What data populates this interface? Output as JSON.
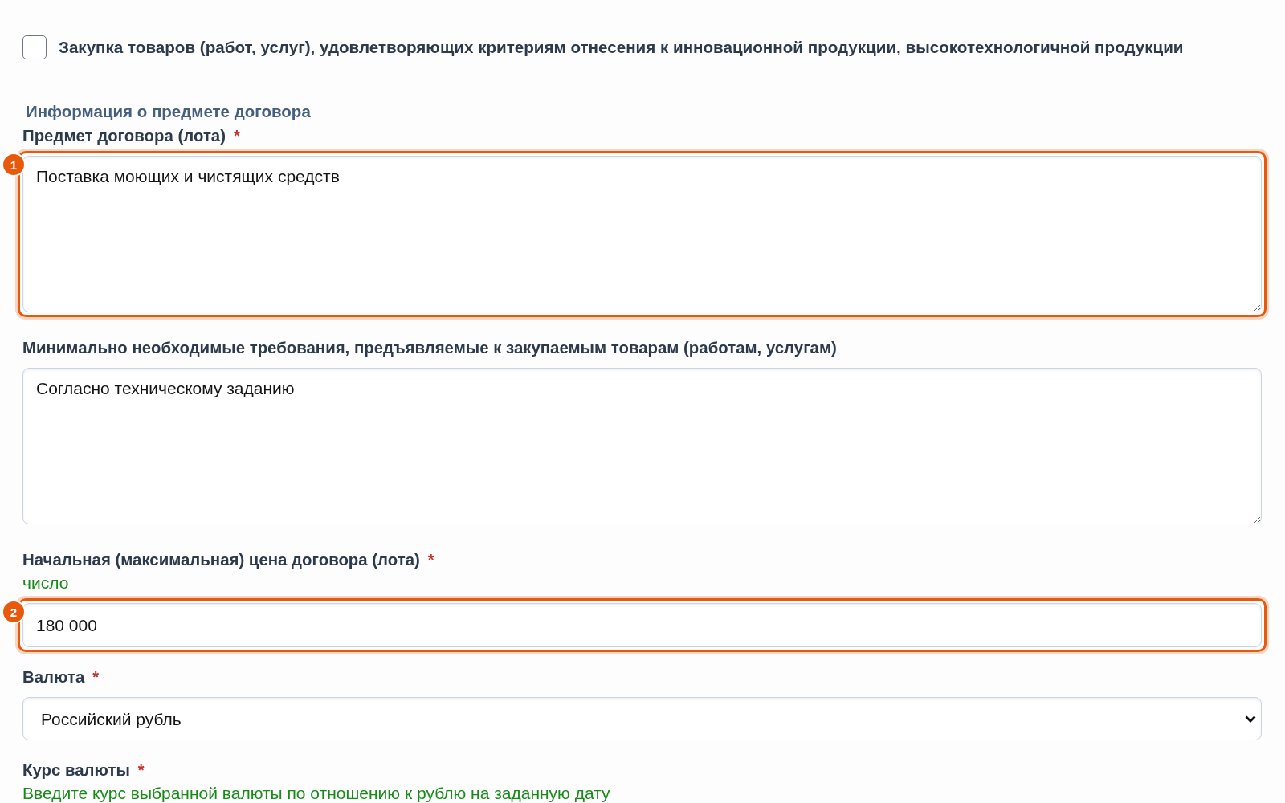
{
  "checkbox": {
    "label": "Закупка товаров (работ, услуг), удовлетворяющих критериям отнесения к инновационной продукции, высокотехнологичной продукции",
    "checked": false
  },
  "section_title": "Информация о предмете договора",
  "fields": [
    {
      "kind": "textarea",
      "label": "Предмет договора (лота)",
      "required_mark": "*",
      "value": "Поставка моющих и чистящих средств",
      "highlight": "1"
    },
    {
      "kind": "textarea",
      "label": "Минимально необходимые требования, предъявляемые к закупаемым товарам (работам, услугам)",
      "value": "Согласно техническому заданию"
    },
    {
      "kind": "input",
      "label": "Начальная (максимальная) цена договора (лота)",
      "required_mark": "*",
      "hint": "число",
      "value": "180 000",
      "highlight": "2"
    },
    {
      "kind": "select",
      "label": "Валюта",
      "required_mark": "*",
      "value": "Российский рубль"
    },
    {
      "kind": "label_only",
      "label": "Курс валюты",
      "required_mark": "*",
      "hint": "Введите курс выбранной валюты по отношению к рублю на заданную дату"
    }
  ]
}
